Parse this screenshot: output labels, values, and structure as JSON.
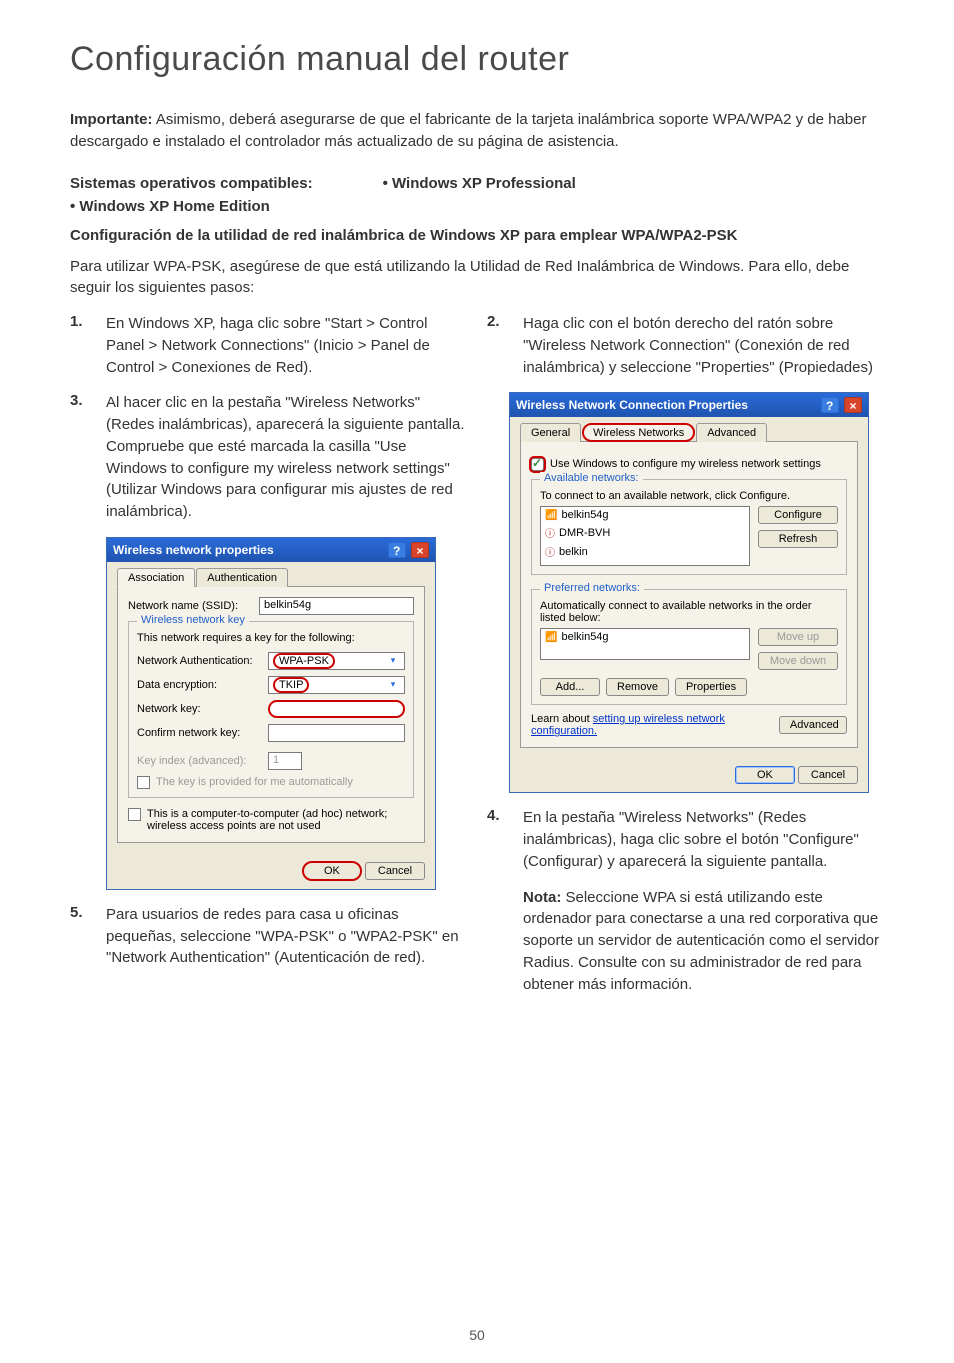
{
  "title": "Configuración manual del router",
  "intro": {
    "bold": "Importante:",
    "rest": " Asimismo, deberá asegurarse de que el fabricante de la tarjeta inalámbrica soporte WPA/WPA2 y de haber descargado e instalado el controlador más actualizado de su página de asistencia."
  },
  "os_row": {
    "left": "Sistemas operativos compatibles:",
    "right": "• Windows XP Professional"
  },
  "xp_home": "• Windows XP Home Edition",
  "config_heading": "Configuración de la utilidad de red inalámbrica de Windows XP para emplear WPA/WPA2-PSK",
  "para1": "Para utilizar WPA-PSK, asegúrese de que está utilizando la Utilidad de Red Inalámbrica de Windows. Para ello, debe seguir los siguientes pasos:",
  "steps": {
    "s1": {
      "num": "1.",
      "body": "En Windows XP, haga clic sobre \"Start > Control Panel > Network Connections\" (Inicio > Panel de Control > Conexiones de Red)."
    },
    "s2": {
      "num": "2.",
      "body": "Haga clic con el botón derecho del ratón sobre \"Wireless Network Connection\" (Conexión de red inalámbrica) y seleccione \"Properties\" (Propiedades)"
    },
    "s3": {
      "num": "3.",
      "body": "Al hacer clic en la pestaña \"Wireless Networks\" (Redes inalámbricas), aparecerá la siguiente pantalla. Compruebe que esté marcada la casilla \"Use Windows to configure my wireless network settings\" (Utilizar Windows para configurar mis ajustes de red inalámbrica)."
    },
    "s4": {
      "num": "4.",
      "body": "En la pestaña \"Wireless Networks\" (Redes inalámbricas), haga clic sobre el botón \"Configure\" (Configurar) y aparecerá la siguiente pantalla."
    },
    "s5": {
      "num": "5.",
      "body": "Para usuarios de redes para casa u oficinas pequeñas, seleccione \"WPA-PSK\" o \"WPA2-PSK\" en \"Network Authentication\" (Autenticación de red)."
    }
  },
  "nota": {
    "bold": "Nota:",
    "rest": " Seleccione WPA si está utilizando este ordenador para conectarse a una red corporativa que soporte un servidor de autenticación como el servidor Radius. Consulte con su administrador de red para obtener más información."
  },
  "dialog1": {
    "title": "Wireless network properties",
    "tab_assoc": "Association",
    "tab_auth": "Authentication",
    "ssid_label": "Network name (SSID):",
    "ssid_value": "belkin54g",
    "group_title": "Wireless network key",
    "group_desc": "This network requires a key for the following:",
    "auth_label": "Network Authentication:",
    "auth_value": "WPA-PSK",
    "enc_label": "Data encryption:",
    "enc_value": "TKIP",
    "key_label": "Network key:",
    "confirm_label": "Confirm network key:",
    "keyidx_label": "Key index (advanced):",
    "keyidx_value": "1",
    "autokey": "The key is provided for me automatically",
    "adhoc": "This is a computer-to-computer (ad hoc) network; wireless access points are not used",
    "ok": "OK",
    "cancel": "Cancel"
  },
  "dialog2": {
    "title": "Wireless Network Connection Properties",
    "tab_general": "General",
    "tab_wireless": "Wireless Networks",
    "tab_advanced": "Advanced",
    "usewin": "Use Windows to configure my wireless network settings",
    "avail_title": "Available networks:",
    "avail_desc": "To connect to an available network, click Configure.",
    "net1": "belkin54g",
    "net2": "DMR-BVH",
    "net3": "belkin",
    "configure": "Configure",
    "refresh": "Refresh",
    "pref_title": "Preferred networks:",
    "pref_desc": "Automatically connect to available networks in the order listed below:",
    "pref1": "belkin54g",
    "moveup": "Move up",
    "movedown": "Move down",
    "add": "Add...",
    "remove": "Remove",
    "properties": "Properties",
    "learn": "Learn about ",
    "learn_link": "setting up wireless network configuration.",
    "advanced_btn": "Advanced",
    "ok": "OK",
    "cancel": "Cancel"
  },
  "page_number": "50"
}
